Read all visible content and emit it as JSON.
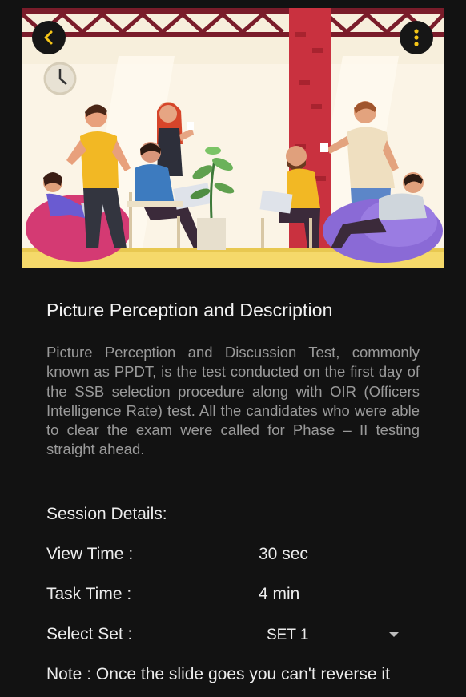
{
  "header": {
    "back_icon": "chevron-left-icon",
    "menu_icon": "more-vertical-icon",
    "accent_color": "#f5c518"
  },
  "hero": {
    "image_description": "Illustration of people relaxing and talking in an office lounge"
  },
  "content": {
    "title": "Picture Perception and Description",
    "description": "Picture Perception and Discussion Test, commonly known as PPDT, is the test conducted on the first day of the SSB selection procedure along with OIR (Officers Intelligence Rate) test. All the candidates who were able to clear the exam were called for Phase – II testing straight ahead."
  },
  "session": {
    "heading": "Session Details:",
    "view_time_label": "View Time :",
    "view_time_value": "30 sec",
    "task_time_label": "Task Time :",
    "task_time_value": "4 min",
    "select_set_label": "Select Set :",
    "select_set_value": "SET 1",
    "note": "Note : Once the slide goes you can't reverse it"
  }
}
